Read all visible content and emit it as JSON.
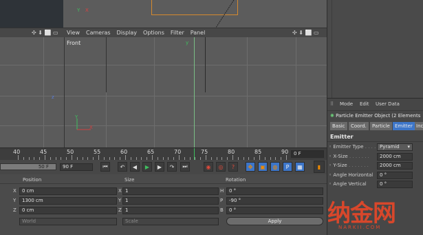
{
  "viewport_menu": [
    "View",
    "Cameras",
    "Display",
    "Options",
    "Filter",
    "Panel"
  ],
  "viewport_label": "Front",
  "axis_labels": {
    "y": "Y",
    "x": "X",
    "z": "Z"
  },
  "timeline": {
    "ticks": [
      "40",
      "45",
      "50",
      "55",
      "60",
      "65",
      "70",
      "75",
      "80",
      "85",
      "90"
    ],
    "current_frame": "0 F",
    "end_left": "50 F",
    "end_right": "90 F"
  },
  "coordinates": {
    "headers": {
      "position": "Position",
      "size": "Size",
      "rotation": "Rotation"
    },
    "rows": [
      {
        "axis": "X",
        "position": "0 cm",
        "size_axis": "X",
        "size": "1",
        "rot_axis": "H",
        "rotation": "0 °"
      },
      {
        "axis": "Y",
        "position": "1300 cm",
        "size_axis": "Y",
        "size": "1",
        "rot_axis": "P",
        "rotation": "-90 °"
      },
      {
        "axis": "Z",
        "position": "0 cm",
        "size_axis": "Z",
        "size": "1",
        "rot_axis": "B",
        "rotation": "0 °"
      }
    ],
    "world": "World",
    "scale": "Scale",
    "apply": "Apply"
  },
  "attributes": {
    "menu": [
      "Mode",
      "Edit",
      "User Data"
    ],
    "object_title": "Particle Emitter Object (2 Elements",
    "tabs": [
      "Basic",
      "Coord.",
      "Particle",
      "Emitter",
      "Inc"
    ],
    "active_tab": "Emitter",
    "section": "Emitter",
    "fields": [
      {
        "label": "Emitter Type",
        "value": "Pyramid"
      },
      {
        "label": "X-Size",
        "value": "2000 cm"
      },
      {
        "label": "Y-Size",
        "value": "2000 cm"
      },
      {
        "label": "Angle Horizontal",
        "value": "0 °"
      },
      {
        "label": "Angle Vertical",
        "value": "0 °"
      }
    ]
  },
  "watermark": {
    "text": "纳金网",
    "sub": "NARKII.COM"
  },
  "colors": {
    "accent_orange": "#f08a00",
    "selection_blue": "#3d76c9",
    "green_axis": "#3fbf5f"
  }
}
